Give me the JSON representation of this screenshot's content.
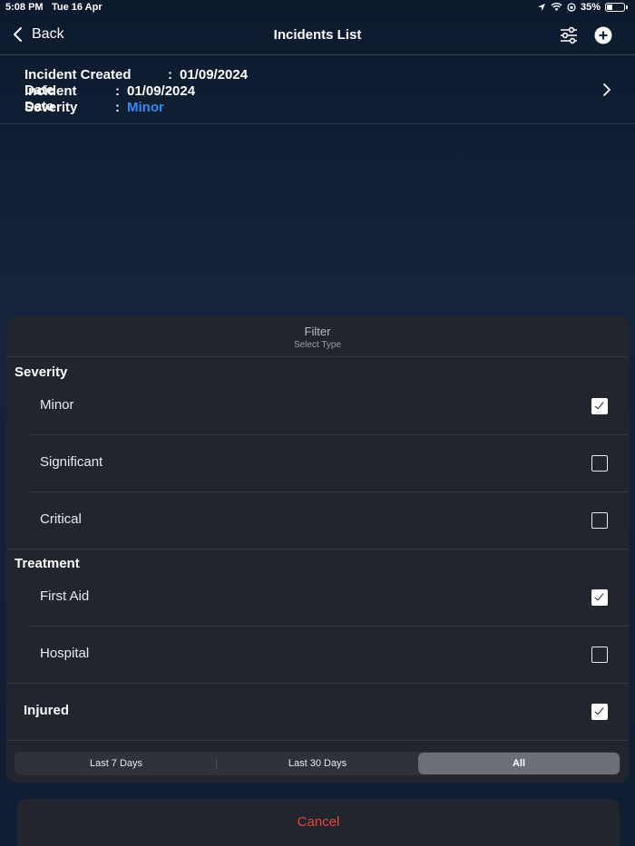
{
  "status_bar": {
    "time": "5:08 PM",
    "date": "Tue 16 Apr",
    "battery": "35%",
    "battery_level": 0.35
  },
  "nav": {
    "back_label": "Back",
    "title": "Incidents List",
    "icons": [
      "filter-sliders-icon",
      "add-circle-icon"
    ]
  },
  "incident": {
    "created_label": "Incident Created Date",
    "created_value": "01/09/2024",
    "date_label": "Incident Date",
    "date_value": "01/09/2024",
    "severity_label": "Severity",
    "severity_value": "Minor",
    "severity_color": "#2f8cf0",
    "colon": ":"
  },
  "filter": {
    "title": "Filter",
    "subtitle": "Select Type",
    "severity_heading": "Severity",
    "severity_options": [
      {
        "label": "Minor",
        "checked": true
      },
      {
        "label": "Significant",
        "checked": false
      },
      {
        "label": "Critical",
        "checked": false
      }
    ],
    "treatment_heading": "Treatment",
    "treatment_options": [
      {
        "label": "First Aid",
        "checked": true
      },
      {
        "label": "Hospital",
        "checked": false
      }
    ],
    "injured": {
      "label": "Injured",
      "checked": true
    },
    "range_options": [
      "Last 7 Days",
      "Last 30 Days",
      "All"
    ],
    "range_selected": "All"
  },
  "cancel_label": "Cancel",
  "colors": {
    "accent": "#2f8cf0",
    "destructive": "#e5453a",
    "sheet_bg": "#22252d"
  }
}
